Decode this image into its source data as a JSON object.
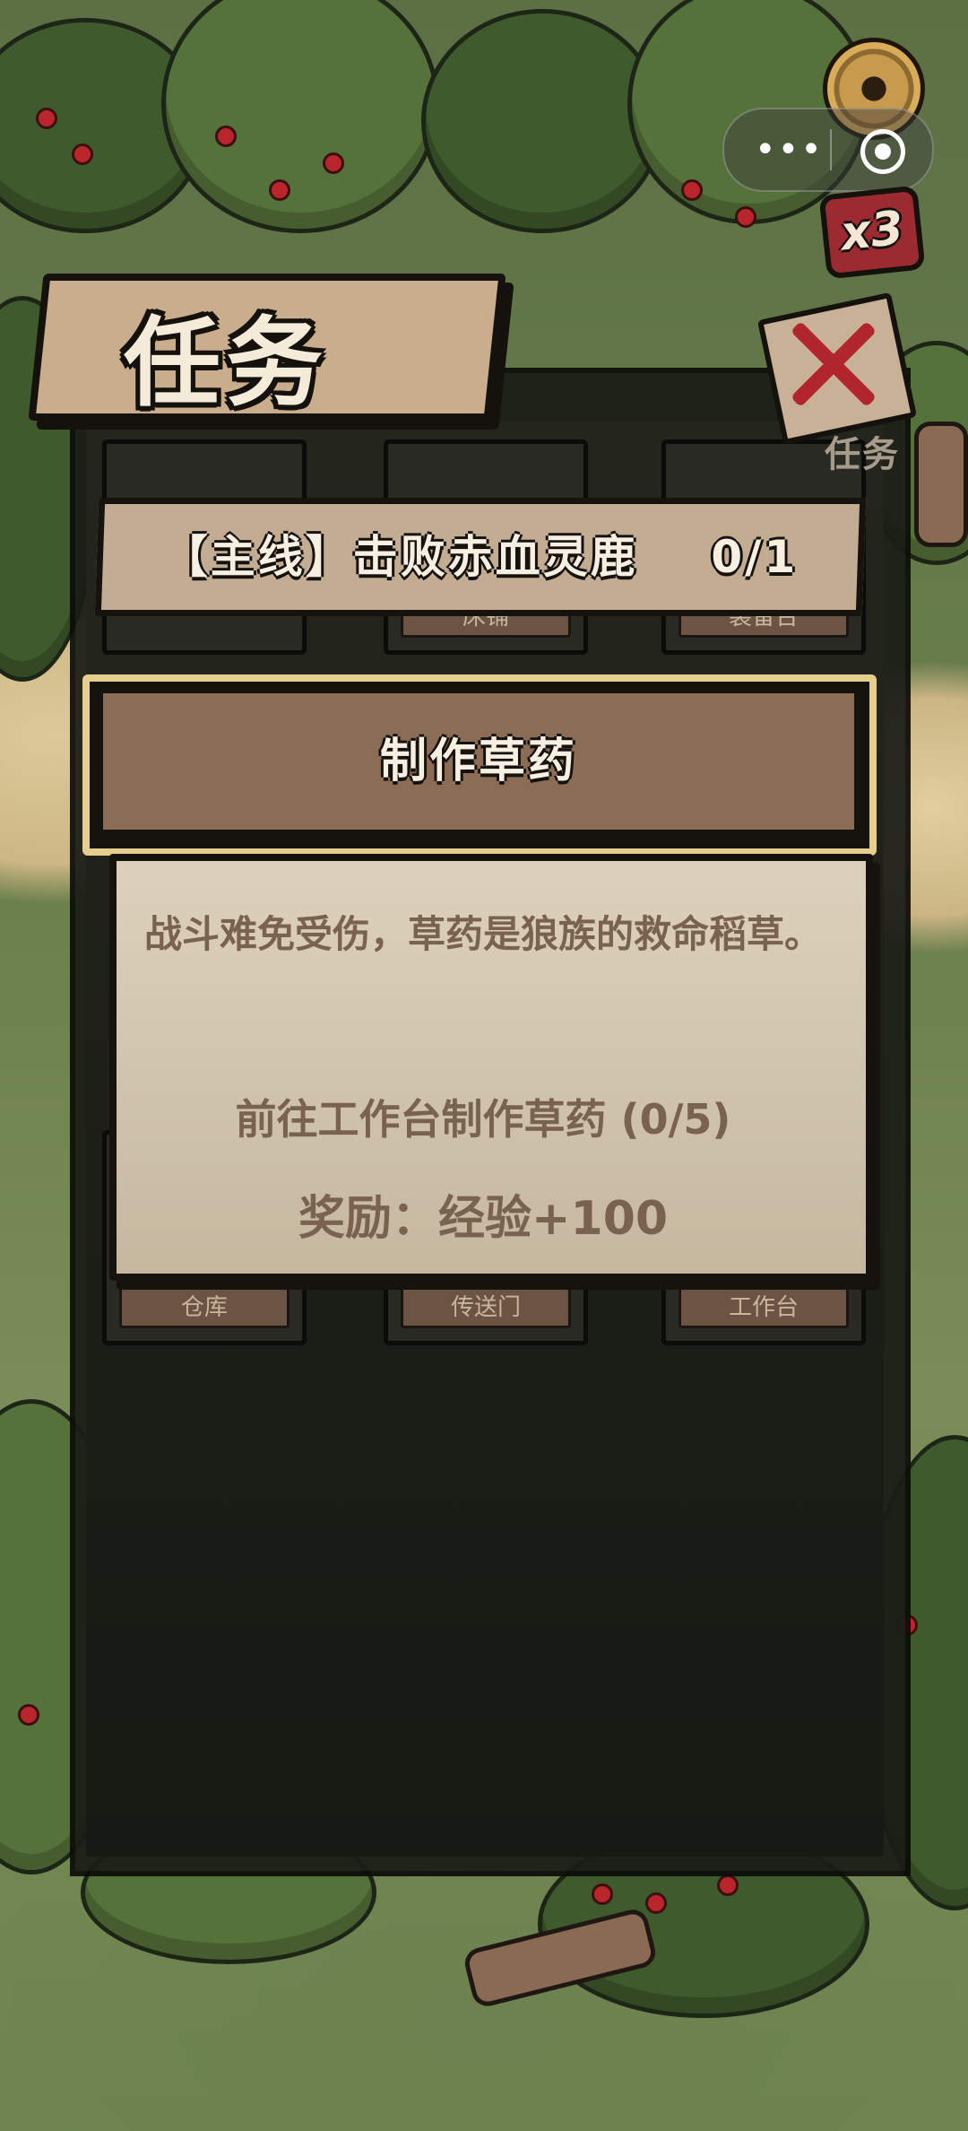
{
  "hud": {
    "menu_dots": "•••",
    "speed_label": "x3"
  },
  "panel": {
    "title": "任务",
    "close_caption": "任务"
  },
  "grid_slots": [
    "",
    "床铺",
    "装备台",
    "仓库",
    "传送门",
    "工作台"
  ],
  "quests": [
    {
      "label": "【主线】击败赤血灵鹿",
      "progress": "0/1"
    },
    {
      "label": "制作草药"
    }
  ],
  "detail": {
    "description": "战斗难免受伤，草药是狼族的救命稻草。",
    "objective": "前往工作台制作草药 (0/5)",
    "reward": "奖励：经验+100"
  },
  "colors": {
    "accent_red": "#b1262c",
    "highlight_gold": "#e6cf8e",
    "parchment": "#d6c9b3",
    "text_brown": "#7a6250"
  }
}
